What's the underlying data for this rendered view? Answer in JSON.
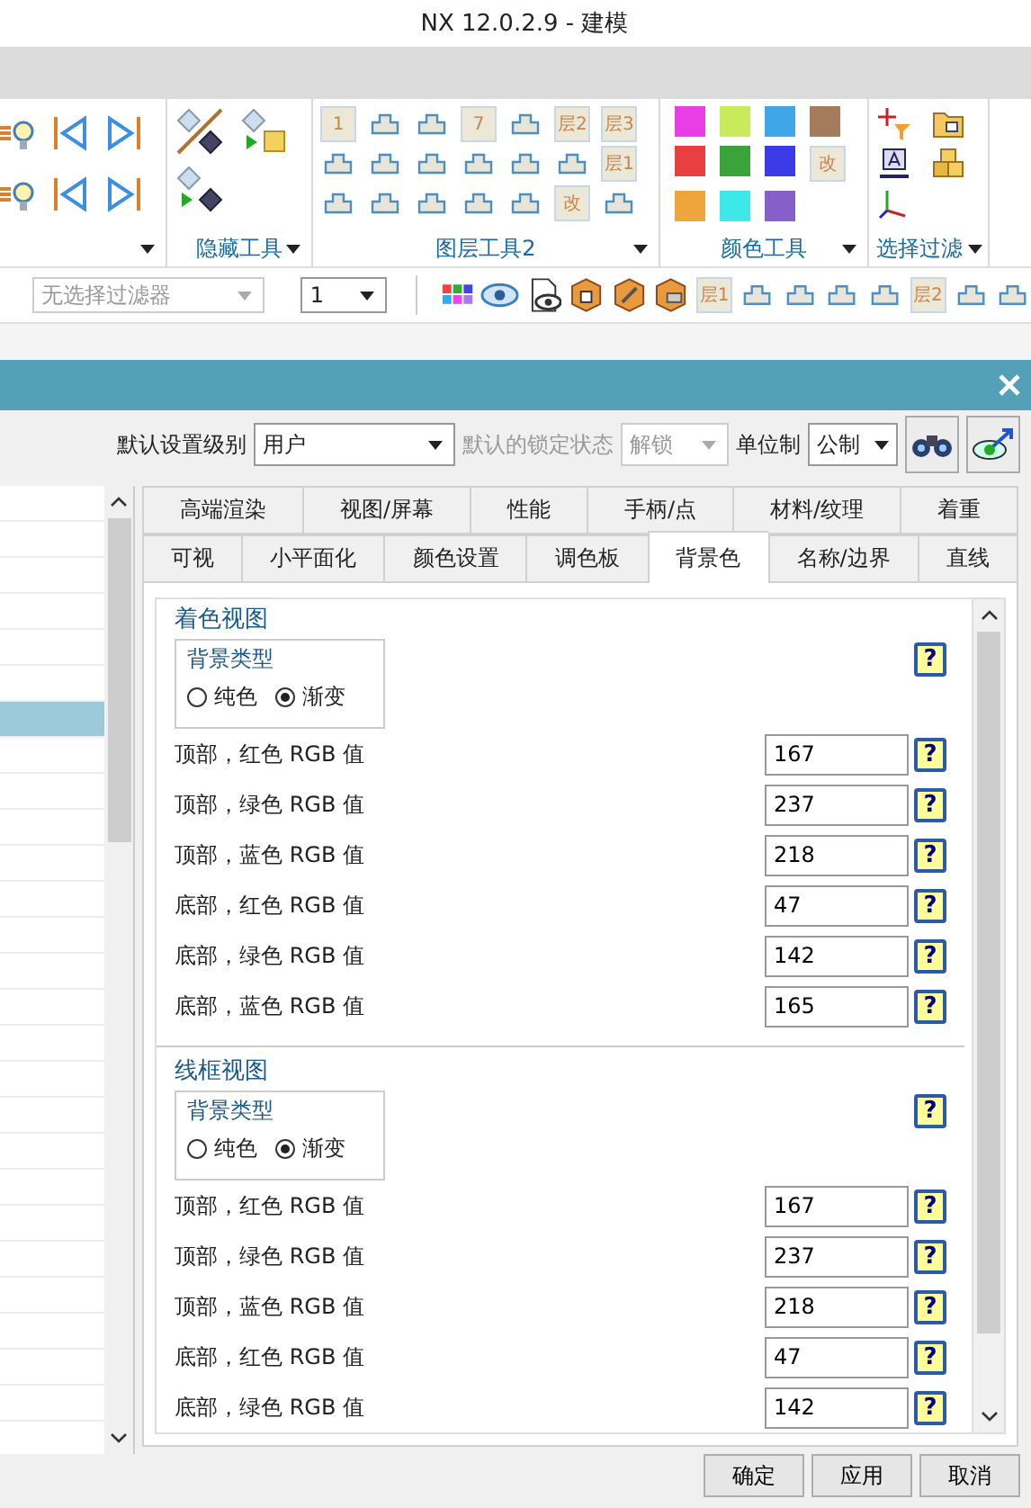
{
  "window": {
    "title": "NX 12.0.2.9 - 建模"
  },
  "ribbon": {
    "groups": [
      {
        "kind": "view"
      },
      {
        "kind": "hide",
        "label": "隐藏工具"
      },
      {
        "kind": "layer",
        "label": "图层工具2",
        "badges": [
          "1",
          "7",
          "层2",
          "层3",
          "层1",
          "改"
        ]
      },
      {
        "kind": "color",
        "label": "颜色工具",
        "swatches": [
          {
            "color": "#e83ee8"
          },
          {
            "color": "#c9ea5a"
          },
          {
            "color": "#3fa7e8"
          },
          {
            "color": "#a57b5e"
          },
          {
            "color": "#e84040"
          },
          {
            "color": "#3aa33a"
          },
          {
            "color": "#3b3be8"
          },
          {
            "color": "#f0a53c"
          },
          {
            "color": "#3ee8e8"
          },
          {
            "color": "#8560c8"
          }
        ],
        "badges": [
          "改"
        ]
      },
      {
        "kind": "filter",
        "label": "选择过滤"
      }
    ]
  },
  "toolbar": {
    "filter": {
      "value": "无选择过滤器",
      "disabled": true
    },
    "layer": {
      "value": "1"
    },
    "badges": [
      "层1",
      "层2"
    ]
  },
  "dialog": {
    "settings_level": {
      "label": "默认设置级别",
      "value": "用户"
    },
    "lock_state": {
      "label": "默认的锁定状态",
      "value": "解锁",
      "disabled": true
    },
    "units": {
      "label": "单位制",
      "value": "公制"
    },
    "list_rows": [
      {
        "selected": false
      },
      {
        "selected": false
      },
      {
        "selected": false
      },
      {
        "selected": false
      },
      {
        "selected": false
      },
      {
        "selected": false
      },
      {
        "selected": true
      },
      {
        "selected": false
      },
      {
        "selected": false
      },
      {
        "selected": false
      },
      {
        "selected": false
      },
      {
        "selected": false
      },
      {
        "selected": false
      },
      {
        "selected": false
      },
      {
        "selected": false
      },
      {
        "selected": false
      },
      {
        "selected": false
      },
      {
        "selected": false
      },
      {
        "selected": false
      },
      {
        "selected": false
      },
      {
        "selected": false
      },
      {
        "selected": false
      },
      {
        "selected": false
      },
      {
        "selected": false
      },
      {
        "selected": false
      },
      {
        "selected": false
      }
    ],
    "tab_rows": [
      [
        {
          "label": "高端渲染",
          "selected": false
        },
        {
          "label": "视图/屏幕",
          "selected": false
        },
        {
          "label": "性能",
          "selected": false
        },
        {
          "label": "手柄/点",
          "selected": false
        },
        {
          "label": "材料/纹理",
          "selected": false
        },
        {
          "label": "着重",
          "selected": false
        }
      ],
      [
        {
          "label": "可视",
          "selected": false
        },
        {
          "label": "小平面化",
          "selected": false
        },
        {
          "label": "颜色设置",
          "selected": false
        },
        {
          "label": "调色板",
          "selected": false
        },
        {
          "label": "背景色",
          "selected": true
        },
        {
          "label": "名称/边界",
          "selected": false
        },
        {
          "label": "直线",
          "selected": false
        }
      ]
    ],
    "sections": [
      {
        "title": "着色视图",
        "help": "?",
        "background_type": {
          "legend": "背景类型",
          "options": [
            {
              "label": "纯色",
              "selected": false
            },
            {
              "label": "渐变",
              "selected": true
            }
          ]
        },
        "rows": [
          {
            "label": "顶部，红色 RGB 值",
            "value": "167",
            "help": "?"
          },
          {
            "label": "顶部，绿色 RGB 值",
            "value": "237",
            "help": "?"
          },
          {
            "label": "顶部，蓝色 RGB 值",
            "value": "218",
            "help": "?"
          },
          {
            "label": "底部，红色 RGB 值",
            "value": "47",
            "help": "?"
          },
          {
            "label": "底部，绿色 RGB 值",
            "value": "142",
            "help": "?"
          },
          {
            "label": "底部，蓝色 RGB 值",
            "value": "165",
            "help": "?"
          }
        ]
      },
      {
        "title": "线框视图",
        "help": "?",
        "background_type": {
          "legend": "背景类型",
          "options": [
            {
              "label": "纯色",
              "selected": false
            },
            {
              "label": "渐变",
              "selected": true
            }
          ]
        },
        "rows": [
          {
            "label": "顶部，红色 RGB 值",
            "value": "167",
            "help": "?"
          },
          {
            "label": "顶部，绿色 RGB 值",
            "value": "237",
            "help": "?"
          },
          {
            "label": "顶部，蓝色 RGB 值",
            "value": "218",
            "help": "?"
          },
          {
            "label": "底部，红色 RGB 值",
            "value": "47",
            "help": "?"
          },
          {
            "label": "底部，绿色 RGB 值",
            "value": "142",
            "help": "?"
          }
        ]
      }
    ],
    "buttons": [
      "确定",
      "应用",
      "取消"
    ]
  }
}
